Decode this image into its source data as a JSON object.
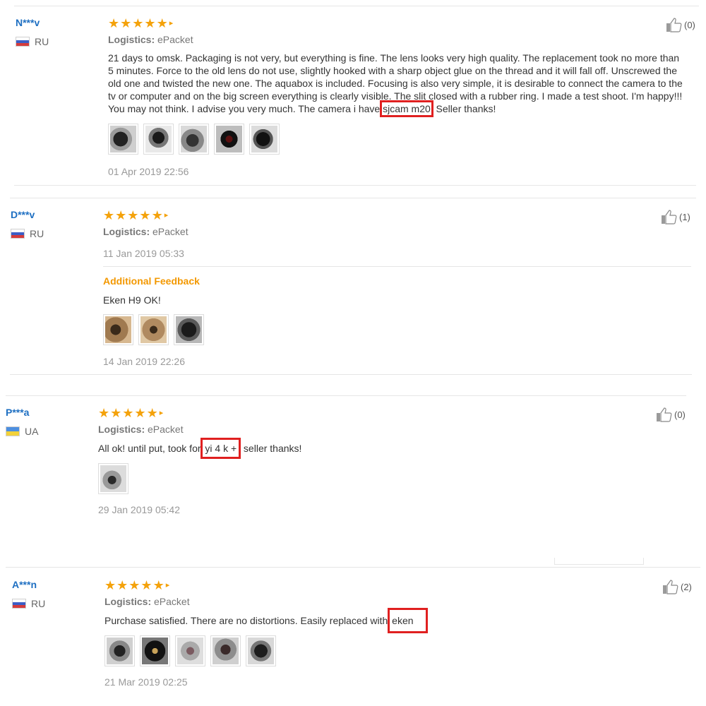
{
  "reviews": [
    {
      "user": "N***v",
      "country": "RU",
      "logistics_label": "Logistics:",
      "logistics_value": "ePacket",
      "text_lines": [
        "21 days to omsk. Packaging is not very, but everything is fine. The lens looks very high quality. The replacement took no more than",
        "5 minutes. Force to the old lens do not use, slightly hooked with a sharp object glue on the thread and it will fall off. Unscrewed the",
        "old one and twisted the new one. The aquabox is included. Focusing is also very simple, it is desirable to connect the camera to the",
        "tv or computer and on the big screen everything is clearly visible. The slit closed with a rubber ring. I made a test shoot. I'm happy!!!"
      ],
      "text_last_before": "You may not think. I advise you very much. The camera i have ",
      "text_last_highlight": "sjcam m20",
      "text_last_after": ". Seller thanks!",
      "date": "01 Apr 2019 22:56",
      "likes": "(0)"
    },
    {
      "user": "D***v",
      "country": "RU",
      "logistics_label": "Logistics:",
      "logistics_value": "ePacket",
      "date": "11 Jan 2019 05:33",
      "additional_title": "Additional Feedback",
      "additional_text": "Eken H9 OK!",
      "additional_date": "14 Jan 2019 22:26",
      "likes": "(1)"
    },
    {
      "user": "P***a",
      "country": "UA",
      "logistics_label": "Logistics:",
      "logistics_value": "ePacket",
      "text_before": "All ok! until put, took for ",
      "text_highlight": "yi 4 k +",
      "text_after": ", seller thanks!",
      "date": "29 Jan 2019 05:42",
      "likes": "(0)"
    },
    {
      "user": "A***n",
      "country": "RU",
      "logistics_label": "Logistics:",
      "logistics_value": "ePacket",
      "text_before": "Purchase satisfied. There are no distortions. Easily replaced with ",
      "text_highlight": "eken",
      "date": "21 Mar 2019 02:25",
      "likes": "(2)"
    }
  ],
  "rating_stars": 5,
  "colors": {
    "star": "#f4a20b",
    "username": "#1e6fc2",
    "highlight": "#e02020",
    "additional_feedback": "#f39800"
  },
  "icons": {
    "like": "thumbs-up-icon",
    "flag_ru": "flag-ru-icon",
    "flag_ua": "flag-ua-icon",
    "star": "star-icon"
  }
}
